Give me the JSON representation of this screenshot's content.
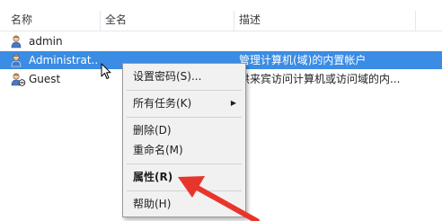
{
  "columns": {
    "name": "名称",
    "fullname": "全名",
    "description": "描述"
  },
  "users": [
    {
      "name": "admin",
      "fullname": "",
      "description": ""
    },
    {
      "name": "Administrat...",
      "fullname": "",
      "description": "管理计算机(域)的内置帐户"
    },
    {
      "name": "Guest",
      "fullname": "",
      "description": "供来宾访问计算机或访问域的内..."
    }
  ],
  "context_menu": {
    "items": [
      {
        "label": "设置密码(S)..."
      },
      {
        "label": "所有任务(K)",
        "submenu_arrow": "▶"
      },
      {
        "label": "删除(D)"
      },
      {
        "label": "重命名(M)"
      },
      {
        "label": "属性(R)"
      },
      {
        "label": "帮助(H)"
      }
    ]
  },
  "colors": {
    "selection": "#3a8ce4",
    "annotation": "#e8352c",
    "menu_bg": "#f1f1f1"
  },
  "icons": {
    "user": "user-icon",
    "cursor": "mouse-cursor-icon",
    "annotation": "red-arrow-annotation"
  }
}
